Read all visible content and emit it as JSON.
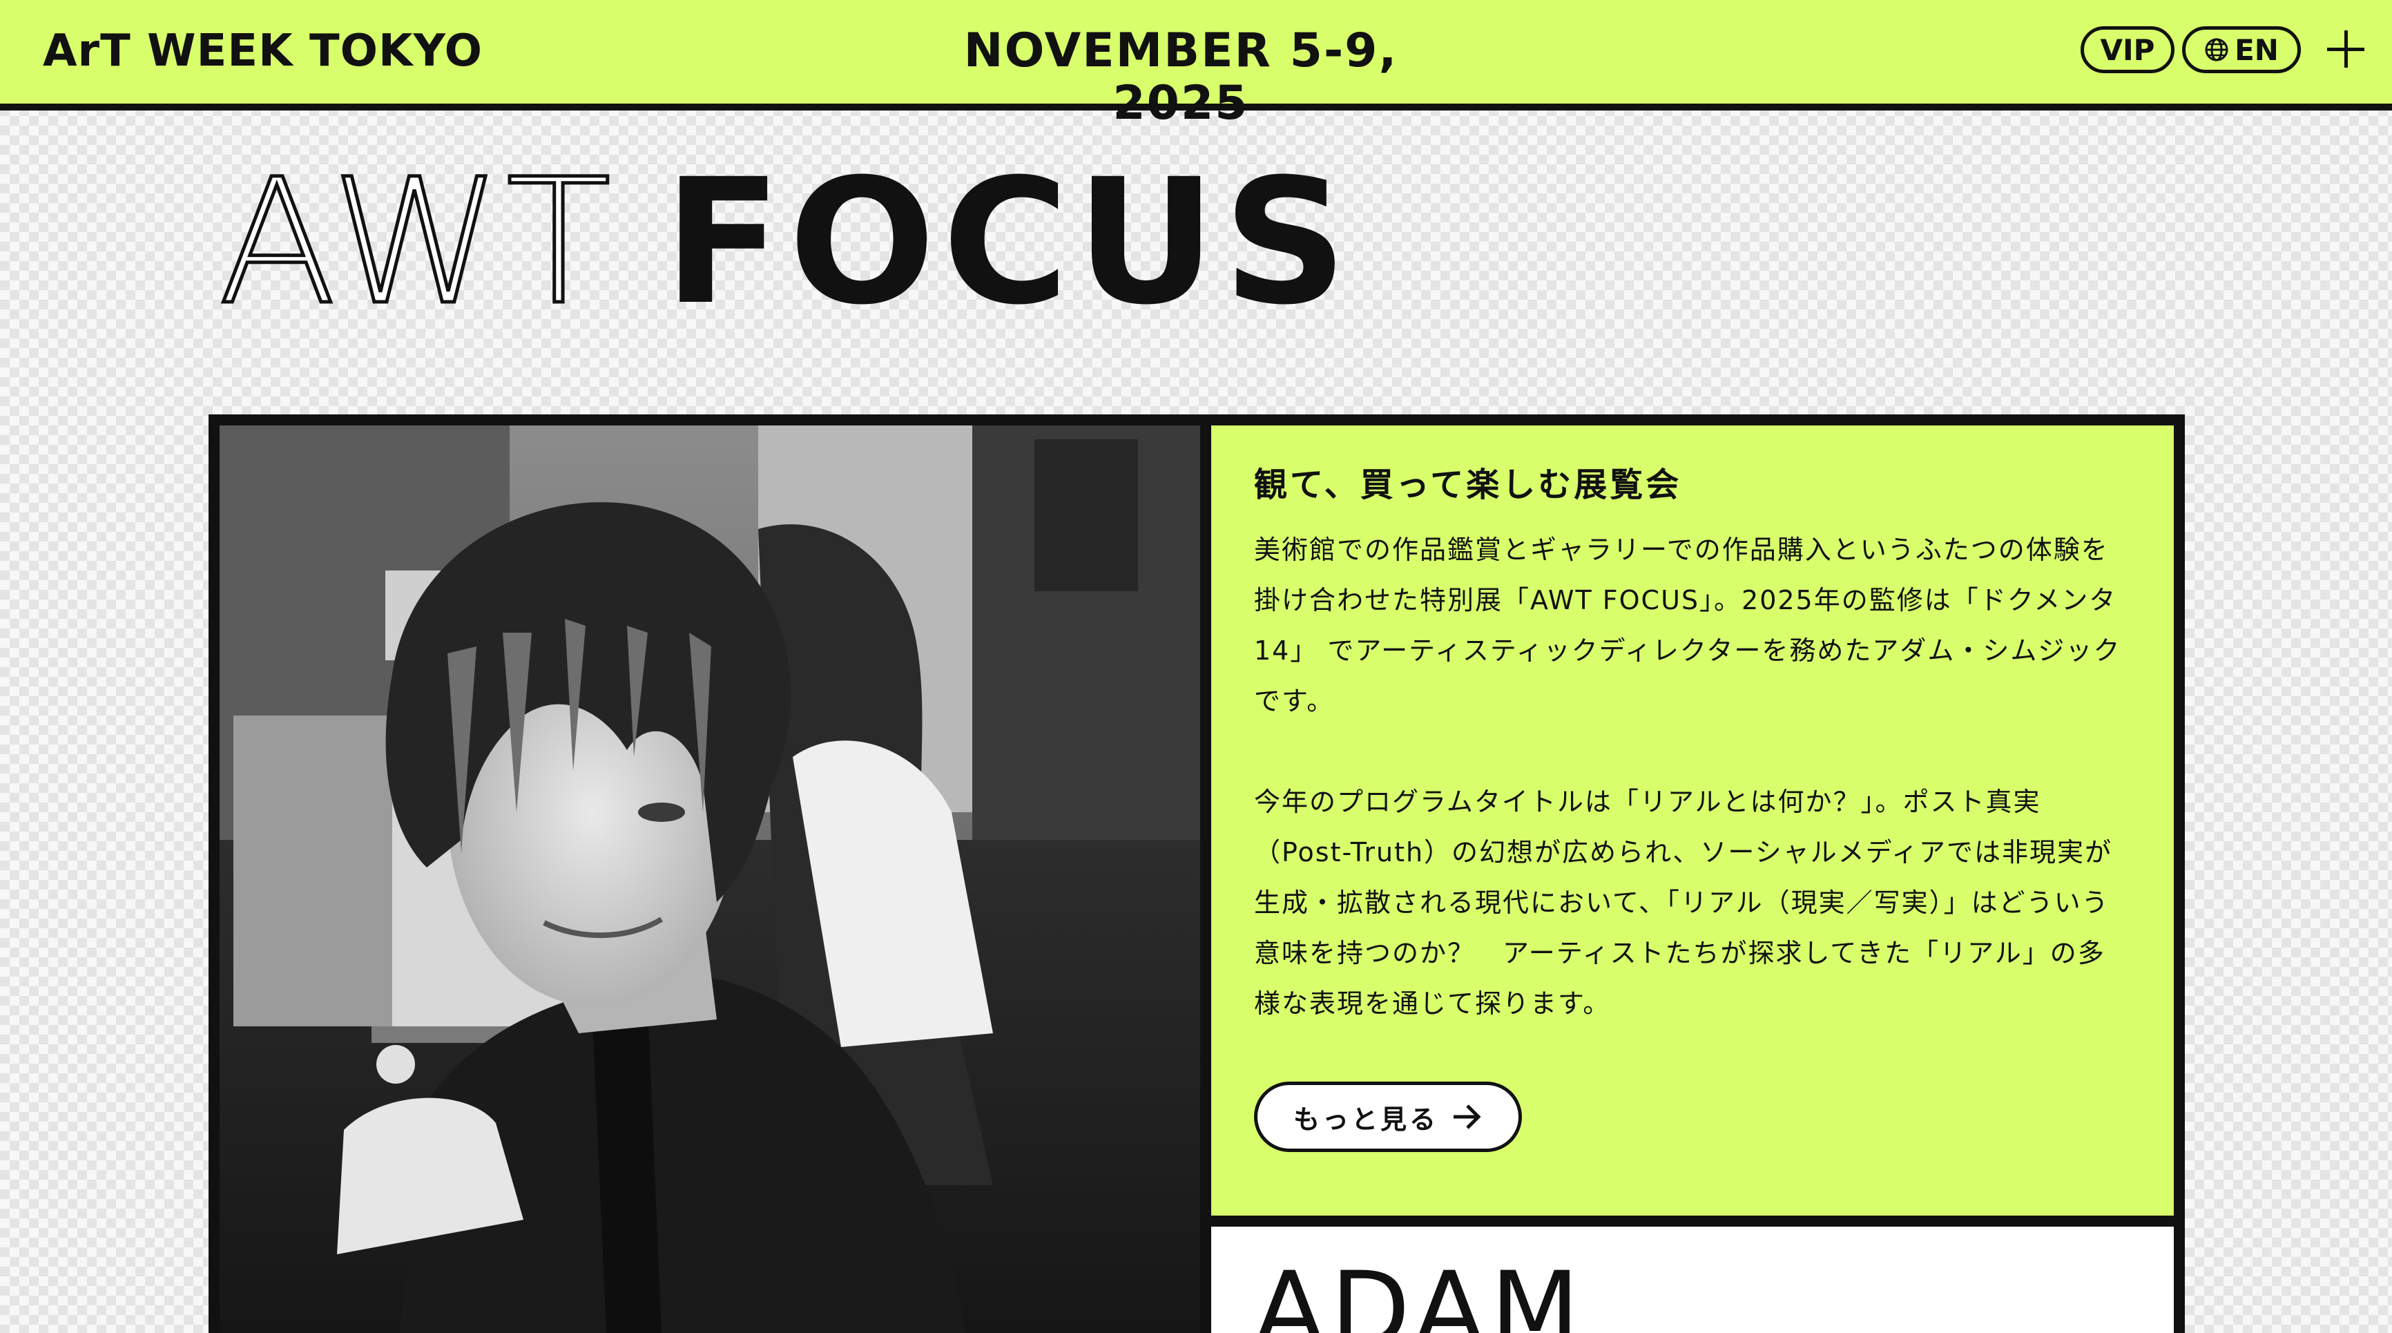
{
  "header": {
    "brand": "ArT WEEK TOKYO",
    "dates": "NOVEMBER 5-9, 2025",
    "vip_label": "VIP",
    "lang_label": "EN",
    "lang_icon": "globe-icon",
    "menu_icon": "plus-icon"
  },
  "title": {
    "outline": "AWT",
    "solid": "FOCUS"
  },
  "info": {
    "heading": "観て、買って楽しむ展覧会",
    "para1": "美術館での作品鑑賞とギャラリーでの作品購入というふたつの体験を\n掛け合わせた特別展「AWT FOCUS」。2025年の監修は「ドクメンタ\n14」 でアーティスティックディレクターを務めたアダム・シムジック\nです。",
    "para2": "今年のプログラムタイトルは「リアルとは何か？」。ポスト真実\n（Post-Truth）の幻想が広められ、ソーシャルメディアでは非現実が\n生成・拡散される現代において、「リアル（現実／写実）」はどういう\n意味を持つのか？　アーティストたちが探求してきた「リアル」の多\n様な表現を通じて探ります。",
    "more_label": "もっと見る",
    "more_icon": "arrow-right-icon"
  },
  "artist": {
    "name": "ADAM"
  },
  "colors": {
    "accent": "#d8ff6b",
    "ink": "#111111",
    "paper": "#ffffff"
  }
}
